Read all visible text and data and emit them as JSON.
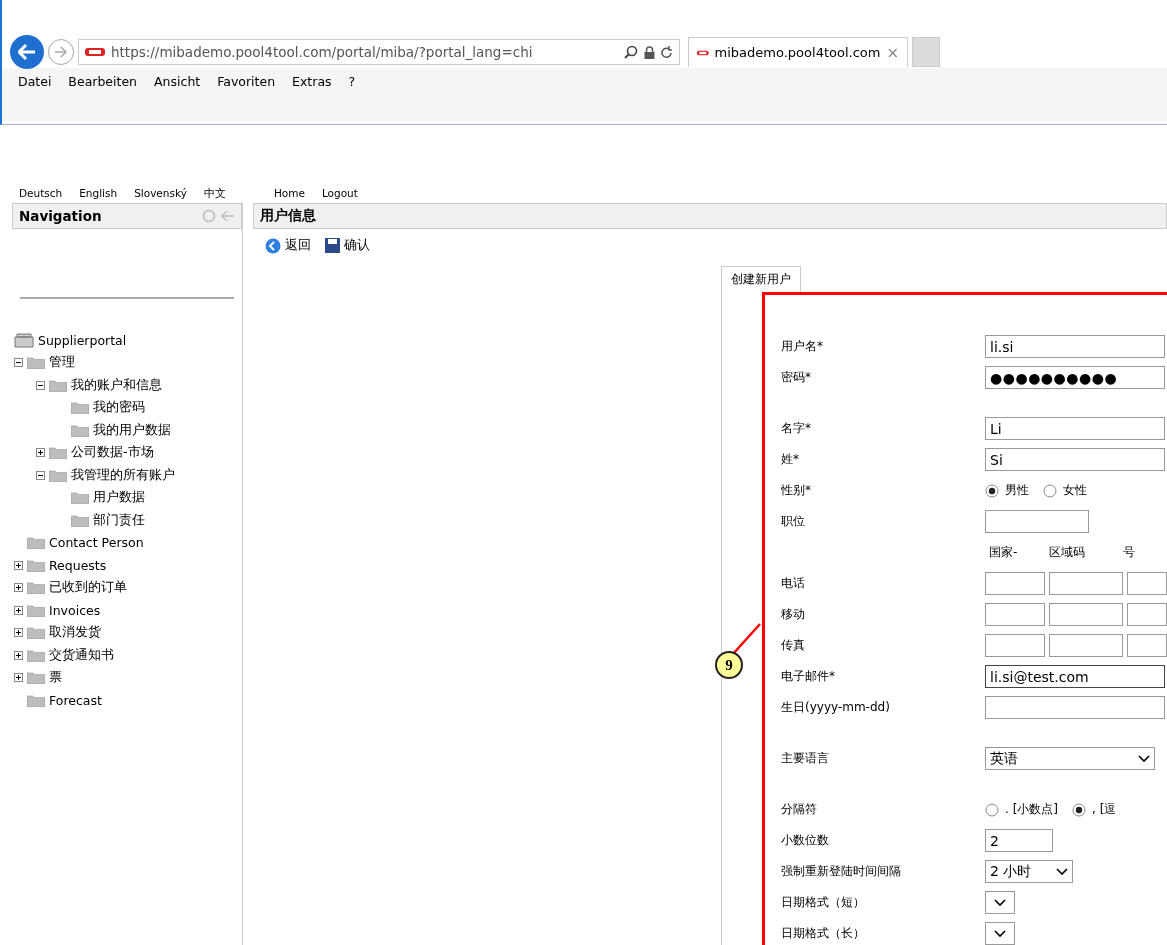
{
  "browser": {
    "url": "https://mibademo.pool4tool.com/portal/miba/?portal_lang=chi",
    "tab_title": "mibademo.pool4tool.com",
    "tab_close": "×",
    "menu": [
      "Datei",
      "Bearbeiten",
      "Ansicht",
      "Favoriten",
      "Extras",
      "?"
    ]
  },
  "language_links": [
    "Deutsch",
    "English",
    "Slovenský",
    "中文"
  ],
  "top_links": [
    "Home",
    "Logout"
  ],
  "navigation": {
    "title": "Navigation",
    "root": "Supplierportal",
    "tree": [
      {
        "label": "管理",
        "expanded": true,
        "children": [
          {
            "label": "我的账户和信息",
            "expanded": true,
            "children": [
              {
                "label": "我的密码"
              },
              {
                "label": "我的用户数据"
              }
            ]
          },
          {
            "label": "公司数据-市场",
            "expanded": false
          },
          {
            "label": "我管理的所有账户",
            "expanded": true,
            "children": [
              {
                "label": "用户数据"
              },
              {
                "label": "部门责任"
              }
            ]
          }
        ]
      },
      {
        "label": "Contact Person"
      },
      {
        "label": "Requests",
        "expanded": false
      },
      {
        "label": "已收到的订单",
        "expanded": false
      },
      {
        "label": "Invoices",
        "expanded": false
      },
      {
        "label": "取消发货",
        "expanded": false
      },
      {
        "label": "交货通知书",
        "expanded": false
      },
      {
        "label": "票",
        "expanded": false
      },
      {
        "label": "Forecast"
      }
    ]
  },
  "content": {
    "title": "用户信息",
    "toolbar": [
      {
        "kind": "back",
        "label": "返回"
      },
      {
        "kind": "save",
        "label": "确认"
      }
    ],
    "tab": "创建新用户",
    "callout": "9",
    "sections": [
      [
        {
          "kind": "text",
          "label": "用户名*",
          "value": "li.si"
        },
        {
          "kind": "password",
          "label": "密码*",
          "value": "●●●●●●●●●●"
        }
      ],
      [
        {
          "kind": "text",
          "label": "名字*",
          "value": "Li"
        },
        {
          "kind": "text",
          "label": "姓*",
          "value": "Si"
        },
        {
          "kind": "radio",
          "label": "性别*",
          "options": [
            {
              "label": "男性",
              "selected": true
            },
            {
              "label": "女性",
              "selected": false
            }
          ]
        },
        {
          "kind": "short",
          "label": "职位"
        },
        {
          "kind": "phone_header",
          "columns": [
            "国家-",
            "区域码",
            "号"
          ]
        },
        {
          "kind": "phone",
          "label": "电话"
        },
        {
          "kind": "phone",
          "label": "移动"
        },
        {
          "kind": "phone",
          "label": "传真"
        },
        {
          "kind": "text",
          "label": "电子邮件*",
          "value": "li.si@test.com",
          "focused": true
        },
        {
          "kind": "text",
          "label": "生日(yyyy-mm-dd)"
        }
      ],
      [
        {
          "kind": "select",
          "label": "主要语言",
          "value": "英语"
        }
      ],
      [
        {
          "kind": "radio",
          "label": "分隔符",
          "options": [
            {
              "label": ". [小数点]",
              "selected": false
            },
            {
              "label": ", [逗",
              "selected": true
            }
          ]
        },
        {
          "kind": "short",
          "label": "小数位数",
          "value": "2"
        },
        {
          "kind": "select_small",
          "label": "强制重新登陆时间间隔",
          "value": "2 小时"
        },
        {
          "kind": "select_tiny",
          "label": "日期格式（短）"
        },
        {
          "kind": "select_tiny",
          "label": "日期格式（长）"
        }
      ]
    ]
  }
}
